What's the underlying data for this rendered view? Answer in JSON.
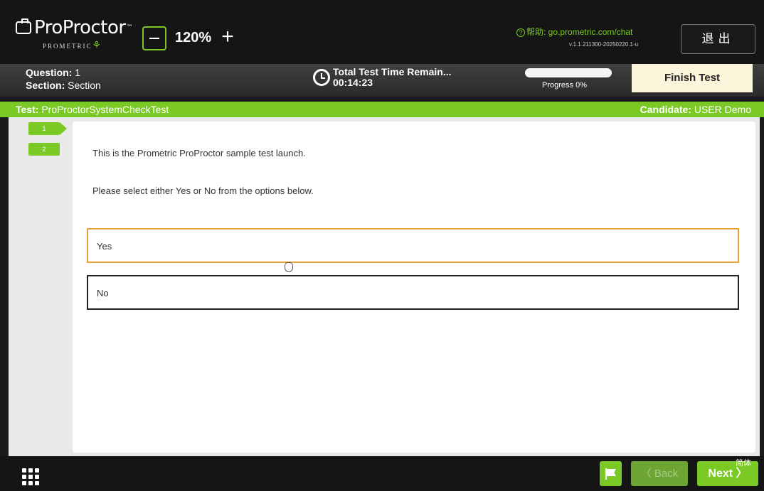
{
  "header": {
    "logo_text": "ProProctor",
    "logo_sub": "PROMETRIC",
    "zoom_level": "120%",
    "zoom_plus_label": "+",
    "help_text": "帮助: go.prometric.com/chat",
    "version": "v.1.1.211300-20250220.1-u",
    "exit_label": "退出"
  },
  "info": {
    "question_label": "Question:",
    "question_value": "1",
    "section_label": "Section:",
    "section_value": "Section",
    "timer_label": "Total Test Time Remain...",
    "timer_value": "00:14:23",
    "progress_label": "Progress 0%",
    "progress_percent": 0,
    "finish_label": "Finish Test"
  },
  "testbar": {
    "test_label": "Test:",
    "test_value": "ProProctorSystemCheckTest",
    "candidate_label": "Candidate:",
    "candidate_value": "USER Demo"
  },
  "nav": {
    "items": [
      "1",
      "2"
    ]
  },
  "question": {
    "stem1": "This is the Prometric ProProctor sample test launch.",
    "stem2": "Please select either Yes or No from the options below.",
    "options": [
      "Yes",
      "No"
    ]
  },
  "footer": {
    "back_label": "〈 Back",
    "next_label": "Next 〉",
    "lang_label": "简体"
  },
  "colors": {
    "accent": "#7bc924",
    "finish_bg": "#fcf4db",
    "option_yes_border": "#e8a23a"
  }
}
